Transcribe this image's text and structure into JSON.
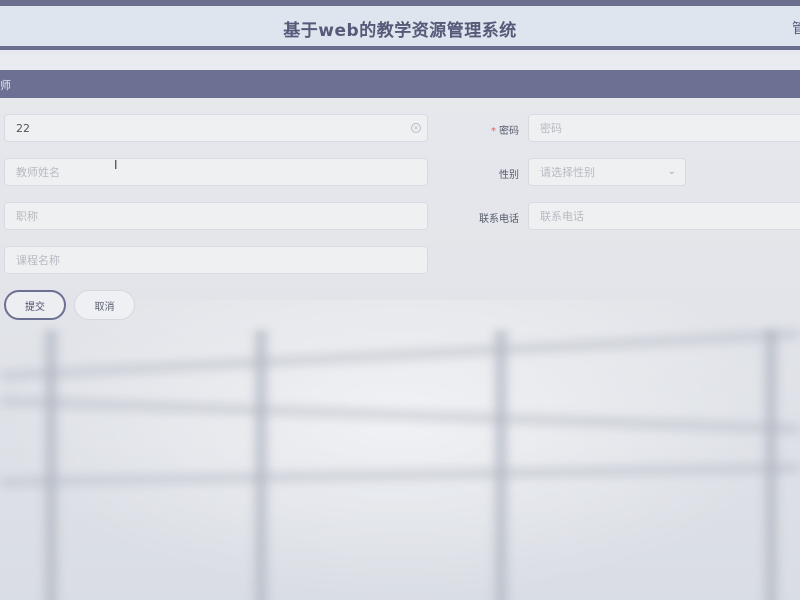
{
  "header": {
    "title": "基于web的教学资源管理系统",
    "user_label": "管"
  },
  "section": {
    "label": "师"
  },
  "form": {
    "account": {
      "value": "22",
      "placeholder": ""
    },
    "password": {
      "label": "密码",
      "placeholder": "密码",
      "required": true
    },
    "teacher_name": {
      "placeholder": "教师姓名"
    },
    "gender": {
      "label": "性别",
      "placeholder": "请选择性别"
    },
    "title": {
      "placeholder": "职称"
    },
    "phone": {
      "label": "联系电话",
      "placeholder": "联系电话"
    },
    "course_name": {
      "placeholder": "课程名称"
    }
  },
  "buttons": {
    "submit": "提交",
    "cancel": "取消"
  },
  "icons": {
    "clear": "circle-close-icon",
    "caret": "chevron-down-icon",
    "cursor": "text-cursor-icon"
  },
  "colors": {
    "accent": "#6c7092",
    "header_bg": "#dfe5ee",
    "title_text": "#555a78",
    "required": "#e05a5a"
  }
}
